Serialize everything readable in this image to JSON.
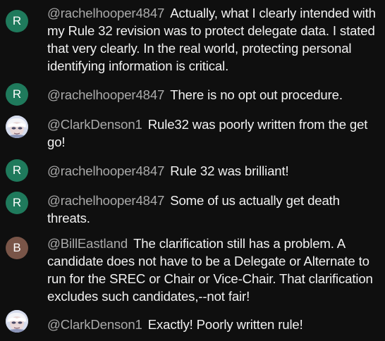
{
  "colors": {
    "background": "#0f0f0f",
    "author": "#aaaaaa",
    "message": "#f1f1f1",
    "avatar_green": "#1f7a5c",
    "avatar_brown": "#795548"
  },
  "messages": [
    {
      "author": "@rachelhooper4847",
      "avatar_letter": "R",
      "text": "Actually, what I clearly intended with my Rule 32 revision was to protect delegate data. I stated that very clearly. In the real world, protecting personal identifying information is critical."
    },
    {
      "author": "@rachelhooper4847",
      "avatar_letter": "R",
      "text": "There is no opt out procedure."
    },
    {
      "author": "@ClarkDenson1",
      "avatar_icon": "face-avatar-icon",
      "text": "Rule32 was poorly written from the get go!"
    },
    {
      "author": "@rachelhooper4847",
      "avatar_letter": "R",
      "text": "Rule 32 was brilliant!"
    },
    {
      "author": "@rachelhooper4847",
      "avatar_letter": "R",
      "text": "Some of us actually get death threats."
    },
    {
      "author": "@BillEastland",
      "avatar_letter": "B",
      "text": "The clarification still has a problem. A candidate does not have to be a Delegate or Alternate to run for the SREC or Chair or Vice-Chair. That clarification excludes such candidates,--not fair!"
    },
    {
      "author": "@ClarkDenson1",
      "avatar_icon": "face-avatar-icon",
      "text": "Exactly! Poorly written rule!"
    }
  ]
}
